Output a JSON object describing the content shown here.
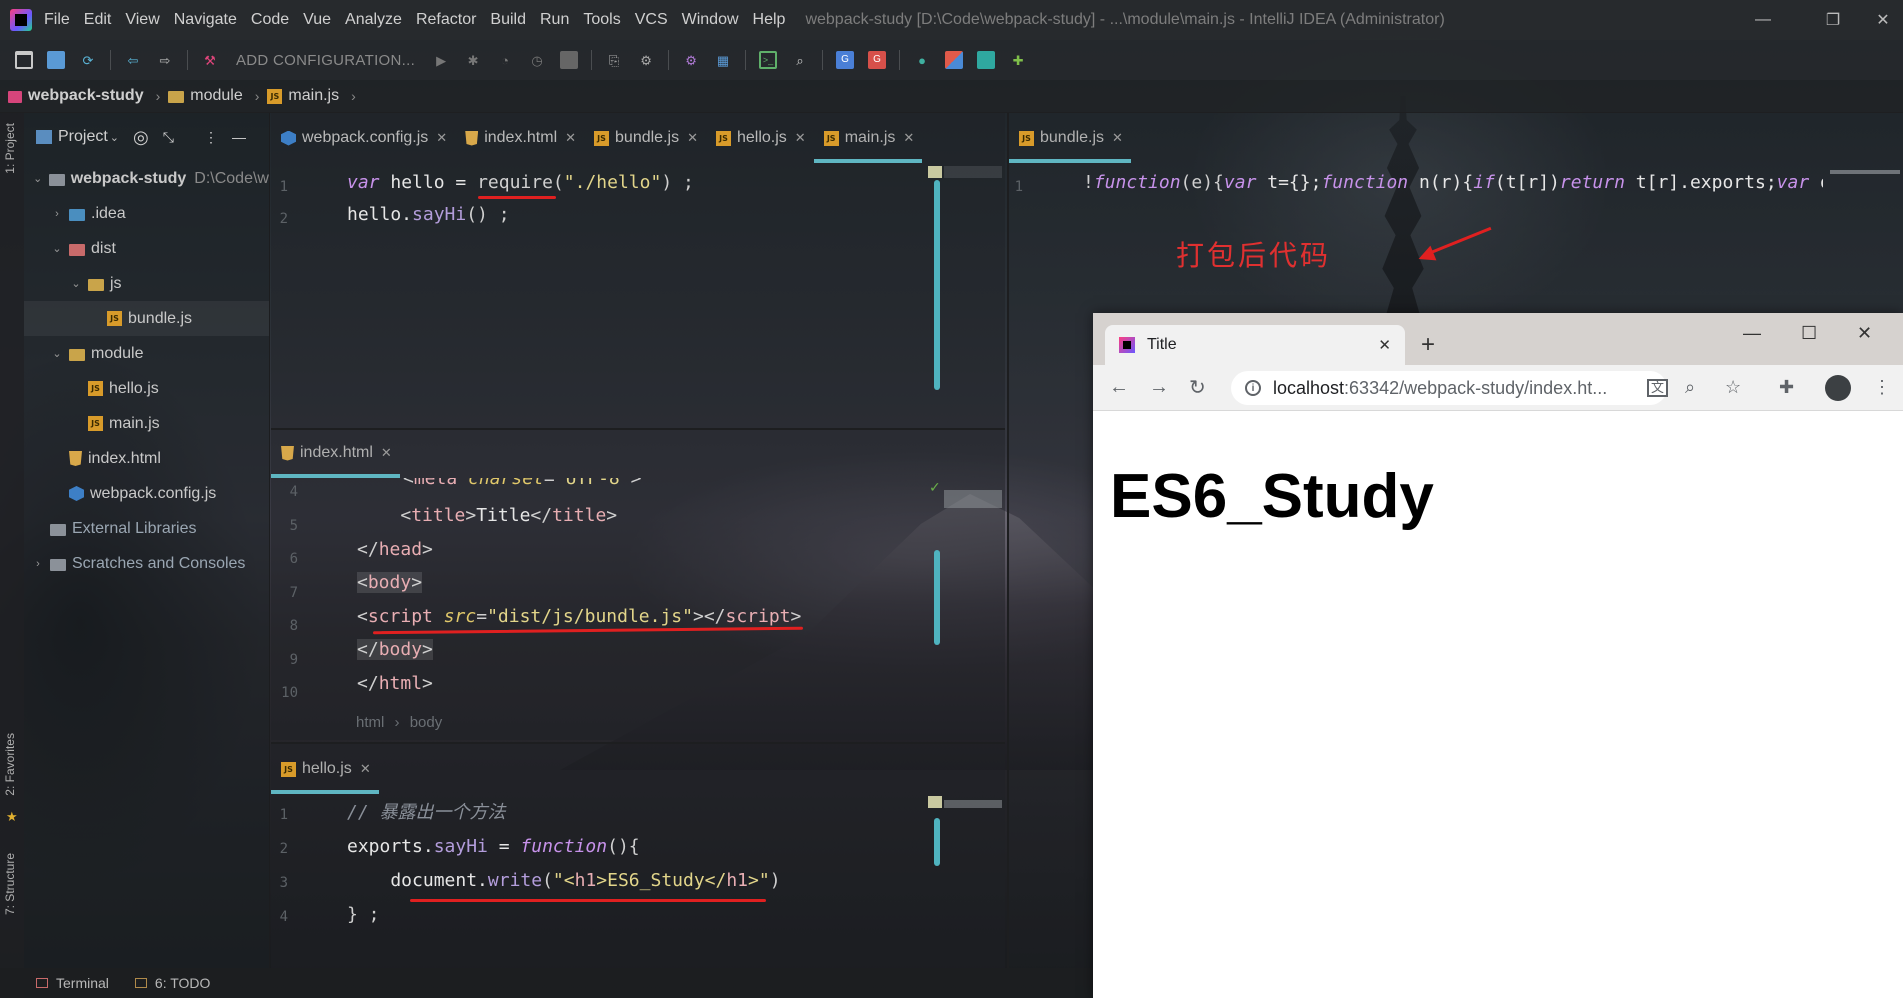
{
  "window": {
    "title": "webpack-study [D:\\Code\\webpack-study] - ...\\module\\main.js - IntelliJ IDEA (Administrator)",
    "menu": [
      "File",
      "Edit",
      "View",
      "Navigate",
      "Code",
      "Vue",
      "Analyze",
      "Refactor",
      "Build",
      "Run",
      "Tools",
      "VCS",
      "Window",
      "Help"
    ],
    "controls": {
      "minimize": "—",
      "restore": "❐",
      "close": "✕"
    }
  },
  "toolbar": {
    "config_label": "ADD CONFIGURATION..."
  },
  "breadcrumb": [
    "webpack-study",
    "module",
    "main.js"
  ],
  "left_strip": {
    "project": "1: Project",
    "favorites": "2: Favorites",
    "structure": "7: Structure"
  },
  "project_panel": {
    "title": "Project",
    "tree": [
      {
        "label": "webpack-study",
        "hint": "D:\\Code\\w",
        "icon": "folder-gray",
        "chevron": "⌄",
        "indent": 0,
        "bold": true
      },
      {
        "label": ".idea",
        "icon": "folder-blue",
        "chevron": "›",
        "indent": 1
      },
      {
        "label": "dist",
        "icon": "folder-red",
        "chevron": "⌄",
        "indent": 1
      },
      {
        "label": "js",
        "icon": "folder-yellow",
        "chevron": "⌄",
        "indent": 2
      },
      {
        "label": "bundle.js",
        "icon": "js",
        "chevron": "",
        "indent": 3
      },
      {
        "label": "module",
        "icon": "folder-yellow",
        "chevron": "⌄",
        "indent": 1
      },
      {
        "label": "hello.js",
        "icon": "js",
        "chevron": "",
        "indent": 2
      },
      {
        "label": "main.js",
        "icon": "js",
        "chevron": "",
        "indent": 2
      },
      {
        "label": "index.html",
        "icon": "html",
        "chevron": "",
        "indent": 1
      },
      {
        "label": "webpack.config.js",
        "icon": "webpack",
        "chevron": "",
        "indent": 1
      },
      {
        "label": "External Libraries",
        "icon": "library",
        "chevron": "",
        "indent": 0
      },
      {
        "label": "Scratches and Consoles",
        "icon": "scratches",
        "chevron": "›",
        "indent": 0
      }
    ]
  },
  "editor_top": {
    "tabs": [
      {
        "label": "webpack.config.js",
        "icon": "webpack",
        "active": false
      },
      {
        "label": "index.html",
        "icon": "html",
        "active": false
      },
      {
        "label": "bundle.js",
        "icon": "js",
        "active": false
      },
      {
        "label": "hello.js",
        "icon": "js",
        "active": false
      },
      {
        "label": "main.js",
        "icon": "js",
        "active": true
      }
    ],
    "line_numbers": [
      "1",
      "2"
    ]
  },
  "editor_index": {
    "tab": "index.html",
    "line_numbers": [
      "4",
      "5",
      "6",
      "7",
      "8",
      "9",
      "10"
    ],
    "crumbs": [
      "html",
      "body"
    ]
  },
  "editor_hello": {
    "tab": "hello.js",
    "line_numbers": [
      "1",
      "2",
      "3",
      "4"
    ]
  },
  "editor_bundle": {
    "tab": "bundle.js",
    "line_numbers": [
      "1"
    ]
  },
  "annotation": {
    "text": "打包后代码"
  },
  "statusbar": {
    "terminal": "Terminal",
    "todo": "6: TODO"
  },
  "browser": {
    "tab_title": "Title",
    "url_host": "localhost",
    "url_rest": ":63342/webpack-study/index.ht...",
    "page_heading": "ES6_Study",
    "controls": {
      "minimize": "—",
      "maximize": "☐",
      "close": "✕"
    }
  }
}
